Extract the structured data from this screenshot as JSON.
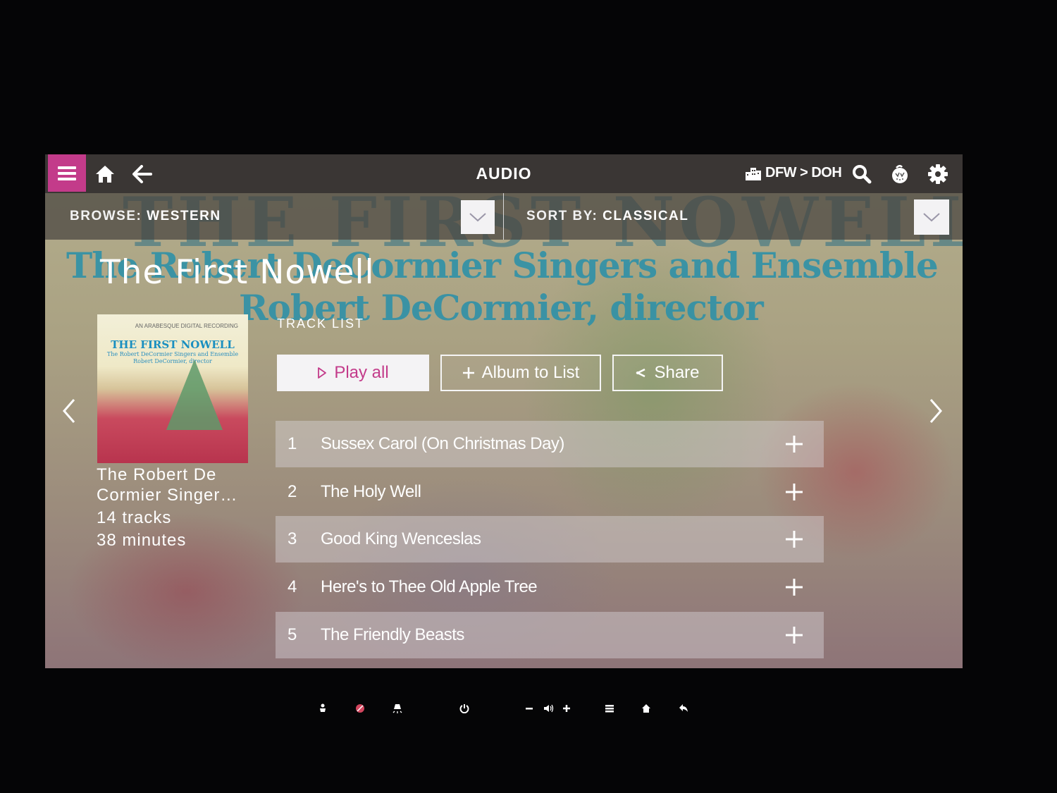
{
  "header": {
    "title": "AUDIO",
    "route": "DFW > DOH",
    "icons": [
      "menu-icon",
      "home-icon",
      "back-arrow-icon",
      "city-icon",
      "search-icon",
      "kids-icon",
      "gear-icon"
    ]
  },
  "filters": {
    "browse_label": "BROWSE:",
    "browse_value": "WESTERN",
    "sort_label": "SORT BY:",
    "sort_value": "CLASSICAL"
  },
  "album": {
    "title": "The First Nowell",
    "artist_truncated": "The Robert De Cormier Singer...",
    "artist_line1": "The Robert De",
    "artist_line2": "Cormier Singer…",
    "tracks_count": "14 tracks",
    "duration": "38 minutes",
    "cover": {
      "top_text": "AN ARABESQUE DIGITAL RECORDING",
      "title": "THE FIRST NOWELL",
      "subtitle1": "The Robert DeCormier Singers and Ensemble",
      "subtitle2": "Robert DeCormier, director"
    }
  },
  "background_art": {
    "line0": "THE FIRST NOWELL",
    "line1": "The Robert DeCormier Singers and Ensemble",
    "line2": "Robert DeCormier, director"
  },
  "tracklist": {
    "label": "TRACK LIST",
    "play_all": "Play all",
    "album_to_list": "Album to List",
    "share": "Share",
    "tracks": [
      {
        "num": "1",
        "name": "Sussex Carol (On Christmas Day)"
      },
      {
        "num": "2",
        "name": "The Holy Well"
      },
      {
        "num": "3",
        "name": "Good King Wenceslas"
      },
      {
        "num": "4",
        "name": "Here's to Thee Old Apple Tree"
      },
      {
        "num": "5",
        "name": "The Friendly Beasts"
      }
    ]
  },
  "colors": {
    "accent": "#c33b8a",
    "topbar": "#3a3634"
  },
  "hardware_controls": [
    "attendant-call-icon",
    "attendant-cancel-icon",
    "reading-light-icon",
    "power-icon",
    "volume-down-icon",
    "volume-icon",
    "volume-up-icon",
    "menu-list-icon",
    "home-icon",
    "back-icon"
  ]
}
